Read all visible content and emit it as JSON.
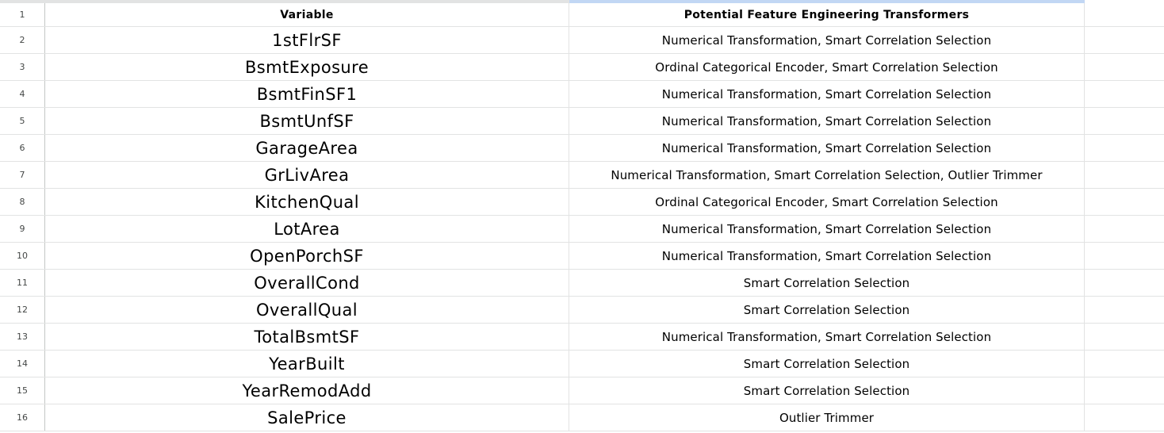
{
  "headers": {
    "variable": "Variable",
    "transformers": "Potential Feature Engineering Transformers"
  },
  "rows": [
    {
      "num": "2",
      "variable": "1stFlrSF",
      "transformers": "Numerical Transformation, Smart Correlation Selection"
    },
    {
      "num": "3",
      "variable": "BsmtExposure",
      "transformers": "Ordinal Categorical Encoder, Smart Correlation Selection"
    },
    {
      "num": "4",
      "variable": "BsmtFinSF1",
      "transformers": "Numerical Transformation, Smart Correlation Selection"
    },
    {
      "num": "5",
      "variable": "BsmtUnfSF",
      "transformers": "Numerical Transformation, Smart Correlation Selection"
    },
    {
      "num": "6",
      "variable": "GarageArea",
      "transformers": "Numerical Transformation, Smart Correlation Selection"
    },
    {
      "num": "7",
      "variable": "GrLivArea",
      "transformers": "Numerical Transformation, Smart Correlation Selection, Outlier Trimmer"
    },
    {
      "num": "8",
      "variable": "KitchenQual",
      "transformers": "Ordinal Categorical Encoder, Smart Correlation Selection"
    },
    {
      "num": "9",
      "variable": "LotArea",
      "transformers": "Numerical Transformation, Smart Correlation Selection"
    },
    {
      "num": "10",
      "variable": "OpenPorchSF",
      "transformers": "Numerical Transformation, Smart Correlation Selection"
    },
    {
      "num": "11",
      "variable": "OverallCond",
      "transformers": "Smart Correlation Selection"
    },
    {
      "num": "12",
      "variable": "OverallQual",
      "transformers": "Smart Correlation Selection"
    },
    {
      "num": "13",
      "variable": "TotalBsmtSF",
      "transformers": "Numerical Transformation, Smart Correlation Selection"
    },
    {
      "num": "14",
      "variable": "YearBuilt",
      "transformers": "Smart Correlation Selection"
    },
    {
      "num": "15",
      "variable": "YearRemodAdd",
      "transformers": "Smart Correlation Selection"
    },
    {
      "num": "16",
      "variable": "SalePrice",
      "transformers": "Outlier Trimmer"
    }
  ],
  "header_row_num": "1",
  "colors": {
    "gridline": "#e2e3e3",
    "rownum_text": "#444746",
    "selected_column_accent": "#c2d7f4"
  }
}
